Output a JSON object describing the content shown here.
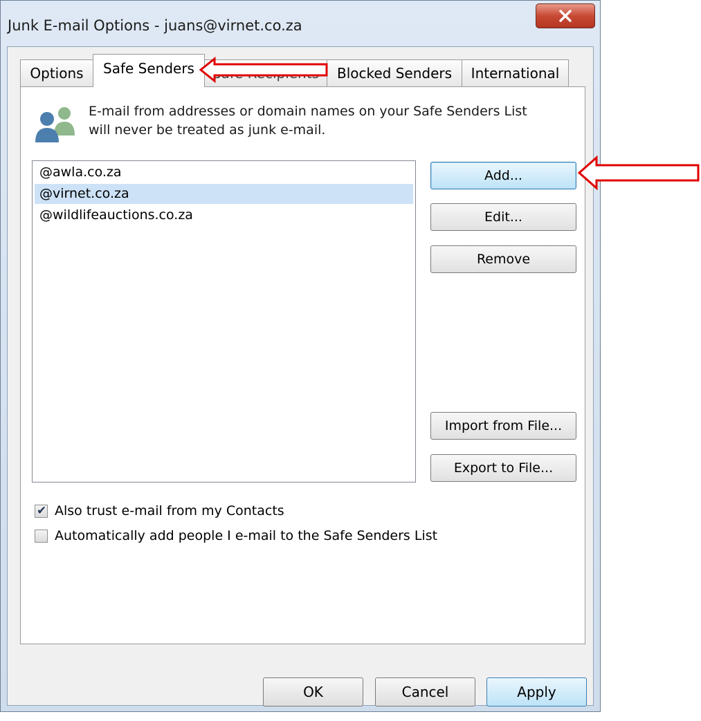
{
  "window": {
    "title": "Junk E-mail Options - juans@virnet.co.za",
    "close_icon": "close-icon"
  },
  "tabs": [
    {
      "label": "Options",
      "active": false
    },
    {
      "label": "Safe Senders",
      "active": true
    },
    {
      "label": "Safe Recipients",
      "active": false
    },
    {
      "label": "Blocked Senders",
      "active": false
    },
    {
      "label": "International",
      "active": false
    }
  ],
  "info": {
    "icon": "people-icon",
    "line1": "E-mail from addresses or domain names on your Safe Senders List",
    "line2": "will never be treated as junk e-mail."
  },
  "safe_senders_list": {
    "items": [
      "@awla.co.za",
      "@virnet.co.za",
      "@wildlifeauctions.co.za"
    ],
    "selected_index": 1
  },
  "side_buttons": {
    "add": "Add...",
    "edit": "Edit...",
    "remove": "Remove",
    "import": "Import from File...",
    "export": "Export to File..."
  },
  "options": {
    "trust_contacts": {
      "label": "Also trust e-mail from my Contacts",
      "checked": true
    },
    "auto_add": {
      "label": "Automatically add people I e-mail to the Safe Senders List",
      "checked": false
    }
  },
  "footer_buttons": {
    "ok": "OK",
    "cancel": "Cancel",
    "apply": "Apply"
  },
  "annotations": {
    "arrow_color": "#e00000",
    "arrows": [
      "pointing to Safe Senders tab",
      "pointing to Add button"
    ]
  },
  "colors": {
    "selection": "#cde2f6",
    "focus_border": "#3c7fb1",
    "close_red": "#c74a35"
  }
}
